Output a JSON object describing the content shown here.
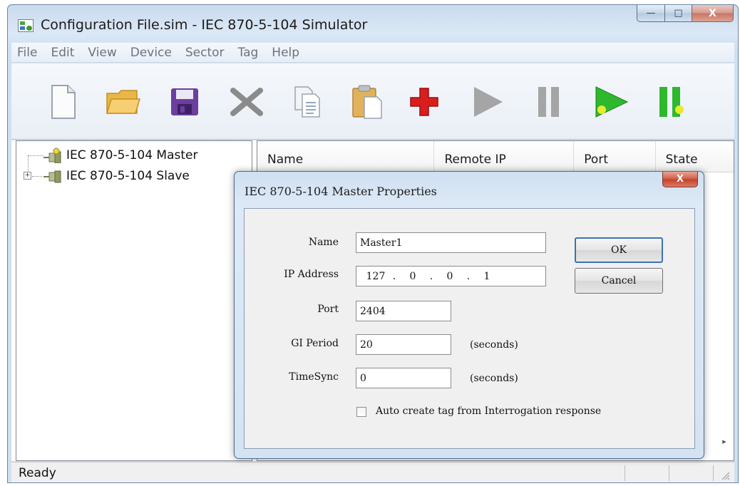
{
  "window": {
    "title": "Configuration File.sim - IEC 870-5-104 Simulator",
    "min_glyph": "—",
    "max_glyph": "□",
    "close_glyph": "X"
  },
  "menu": [
    "File",
    "Edit",
    "View",
    "Device",
    "Sector",
    "Tag",
    "Help"
  ],
  "toolbar": [
    {
      "name": "new-file-icon"
    },
    {
      "name": "open-folder-icon"
    },
    {
      "name": "save-icon"
    },
    {
      "name": "delete-icon"
    },
    {
      "name": "copy-icon"
    },
    {
      "name": "paste-icon"
    },
    {
      "name": "add-icon"
    },
    {
      "name": "play-icon"
    },
    {
      "name": "pause-icon"
    },
    {
      "name": "start-all-icon"
    },
    {
      "name": "pause-all-icon"
    }
  ],
  "tree": {
    "items": [
      {
        "label": "IEC 870-5-104 Master"
      },
      {
        "label": "IEC 870-5-104 Slave",
        "expander": "+"
      }
    ]
  },
  "list": {
    "columns": [
      "Name",
      "Remote IP",
      "Port",
      "State"
    ],
    "scroll_glyph": "▸"
  },
  "status": {
    "text": "Ready"
  },
  "dialog": {
    "title": "IEC 870-5-104 Master Properties",
    "close_glyph": "X",
    "labels": {
      "name": "Name",
      "ip": "IP Address",
      "port": "Port",
      "gi_period": "GI Period",
      "timesync": "TimeSync"
    },
    "values": {
      "name": "Master1",
      "ip": [
        "127",
        "0",
        "0",
        "1"
      ],
      "port": "2404",
      "gi_period": "20",
      "timesync": "0"
    },
    "units": {
      "gi_period": "(seconds)",
      "timesync": "(seconds)"
    },
    "checkbox_label": "Auto create tag from Interrogation response",
    "ip_separator": ".",
    "ok_label": "OK",
    "cancel_label": "Cancel"
  }
}
